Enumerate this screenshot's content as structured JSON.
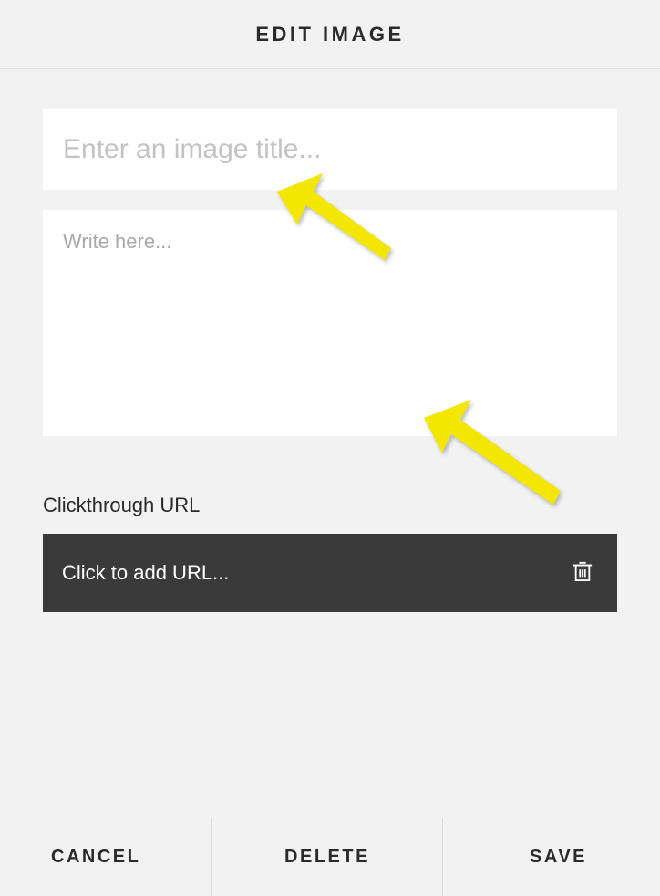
{
  "header": {
    "title": "EDIT IMAGE"
  },
  "fields": {
    "title": {
      "value": "",
      "placeholder": "Enter an image title..."
    },
    "description": {
      "value": "",
      "placeholder": "Write here..."
    }
  },
  "clickthrough": {
    "label": "Clickthrough URL",
    "placeholder": "Click to add URL..."
  },
  "footer": {
    "cancel": "CANCEL",
    "delete": "DELETE",
    "save": "SAVE"
  },
  "colors": {
    "background": "#f2f2f2",
    "panel": "#ffffff",
    "urlbar": "#3a3a3a",
    "text": "#2a2a2a",
    "arrow": "#f3e600"
  }
}
